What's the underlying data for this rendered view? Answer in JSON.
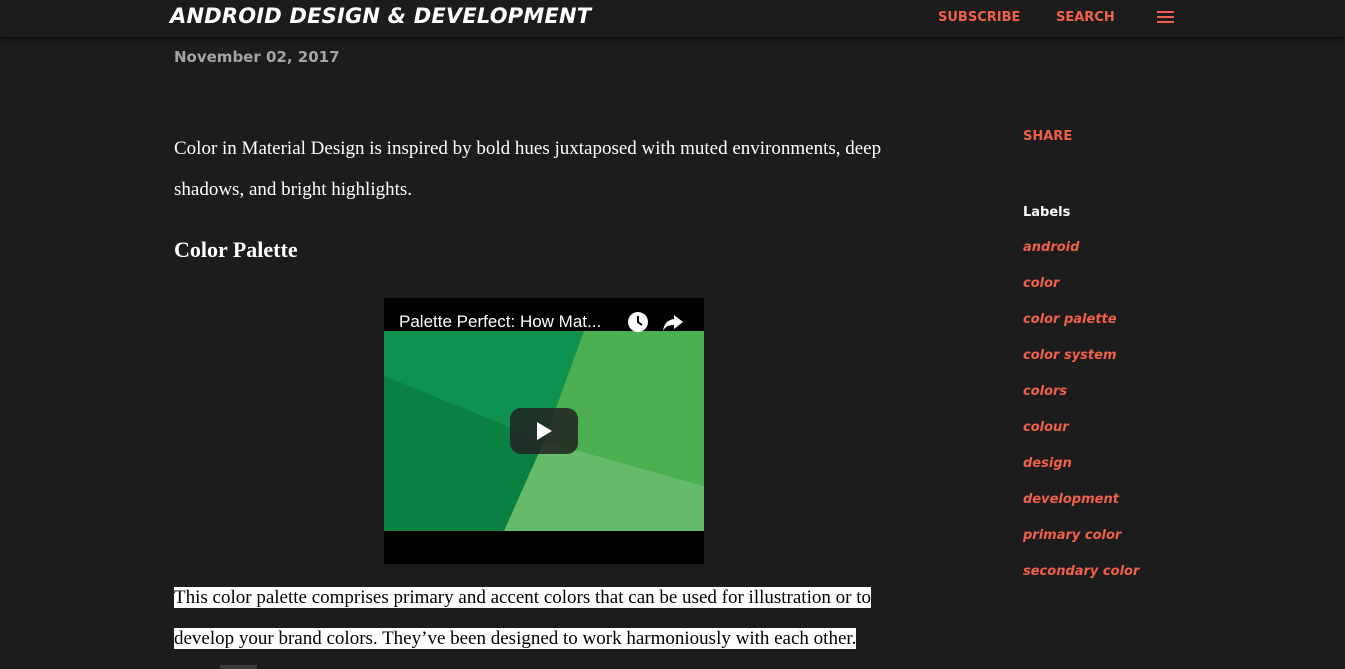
{
  "header": {
    "brand": "ANDROID DESIGN & DEVELOPMENT",
    "subscribe_label": "SUBSCRIBE",
    "search_label": "SEARCH",
    "menu_icon": "hamburger-menu-icon"
  },
  "post": {
    "date": "November 02, 2017",
    "intro": "Color in Material Design is inspired by bold hues juxtaposed with muted environments, deep shadows, and bright highlights.",
    "heading": "Color Palette",
    "video": {
      "title": "Palette Perfect: How Mat...",
      "watch_later_icon": "clock-icon",
      "share_icon": "share-arrow-icon",
      "play_icon": "play-icon"
    },
    "body_line1": "This color palette comprises primary and accent colors that can be used for illustration or to",
    "body_line2": "develop your brand colors. They’ve been designed to work harmoniously with each other."
  },
  "sidebar": {
    "share_label": "SHARE",
    "labels_title": "Labels",
    "labels": [
      "android",
      "color",
      "color palette",
      "color system",
      "colors",
      "colour",
      "design",
      "development",
      "primary color",
      "secondary color"
    ]
  },
  "colors": {
    "accent": "#f0604a",
    "background": "#1c1c1d",
    "date": "#a5a5a5"
  }
}
